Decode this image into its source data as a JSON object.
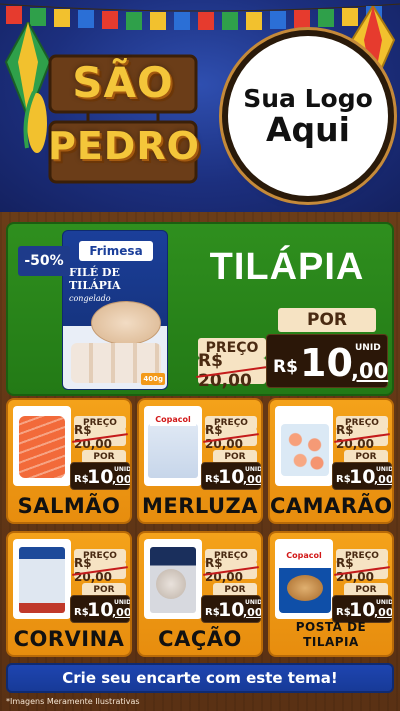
{
  "header": {
    "title_line1": "SÃO",
    "title_line2": "PEDRO",
    "logo_line1": "Sua Logo",
    "logo_line2": "Aqui",
    "colors": {
      "sky": "#1c2f7e",
      "title": "#f4c63a",
      "wood": "#5a3416"
    }
  },
  "main_offer": {
    "discount": "-50%",
    "brand": "Frimesa",
    "package_name": "FILÉ DE TILÁPIA",
    "package_sub": "congelado",
    "package_weight": "400g",
    "title": "TILÁPIA",
    "preco_label": "PREÇO",
    "old_price": "R$ 20,00",
    "por_label": "POR",
    "currency": "R$",
    "price_int": "10",
    "price_cents": ",00",
    "unit": "UNID",
    "bg_color": "#2f8f1e"
  },
  "products": [
    {
      "name": "SALMÃO",
      "preco_label": "PREÇO",
      "old_price": "R$ 20,00",
      "por_label": "POR",
      "currency": "R$",
      "price_int": "10",
      "price_cents": ",00",
      "unit": "UNID",
      "icon": "salmon-image"
    },
    {
      "name": "MERLUZA",
      "preco_label": "PREÇO",
      "old_price": "R$ 20,00",
      "por_label": "POR",
      "currency": "R$",
      "price_int": "10",
      "price_cents": ",00",
      "unit": "UNID",
      "brand": "Copacol",
      "icon": "merluza-image"
    },
    {
      "name": "CAMARÃO",
      "preco_label": "PREÇO",
      "old_price": "R$ 20,00",
      "por_label": "POR",
      "currency": "R$",
      "price_int": "10",
      "price_cents": ",00",
      "unit": "UNID",
      "icon": "shrimp-image"
    },
    {
      "name": "CORVINA",
      "preco_label": "PREÇO",
      "old_price": "R$ 20,00",
      "por_label": "POR",
      "currency": "R$",
      "price_int": "10",
      "price_cents": ",00",
      "unit": "UNID",
      "icon": "corvina-image"
    },
    {
      "name": "CAÇÃO",
      "preco_label": "PREÇO",
      "old_price": "R$ 20,00",
      "por_label": "POR",
      "currency": "R$",
      "price_int": "10",
      "price_cents": ",00",
      "unit": "UNID",
      "icon": "cacao-image"
    },
    {
      "name": "POSTA DE TILAPIA",
      "preco_label": "PREÇO",
      "old_price": "R$ 20,00",
      "por_label": "POR",
      "currency": "R$",
      "price_int": "10",
      "price_cents": ",00",
      "unit": "UNID",
      "brand": "Copacol",
      "icon": "posta-tilapia-image"
    }
  ],
  "footer": {
    "cta": "Crie seu encarte com este tema!",
    "disclaimer": "*Imagens Meramente Ilustrativas"
  }
}
